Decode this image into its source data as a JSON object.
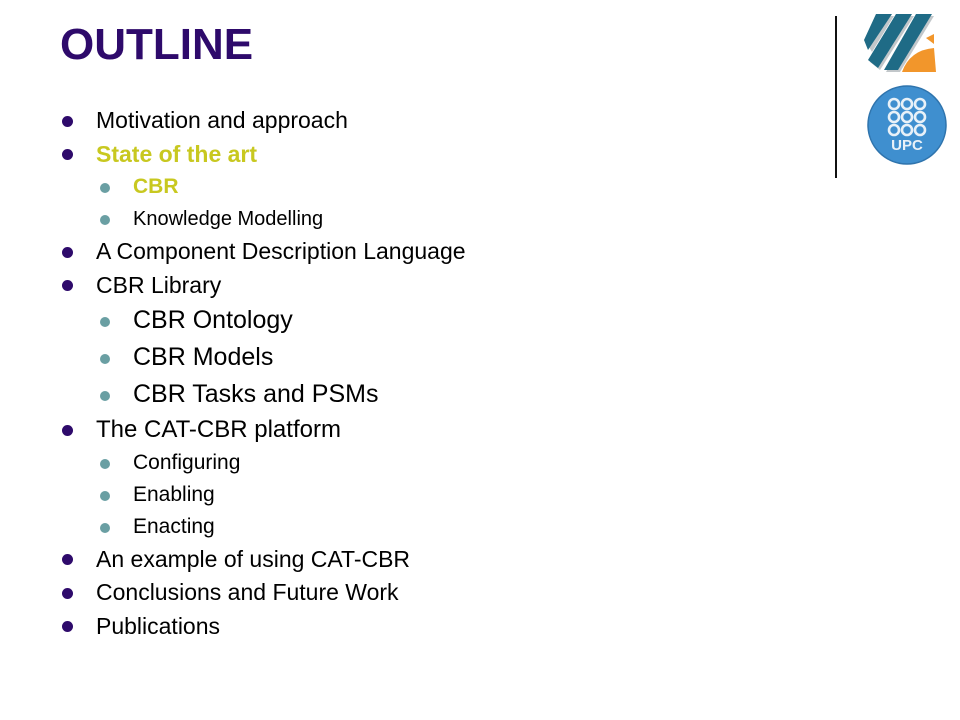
{
  "slide": {
    "title": "OUTLINE",
    "colors": {
      "title": "#2e0a6b",
      "highlight": "#c8c820",
      "bullet_level1": "#2e0a6b",
      "bullet_level2": "#6a9fa3"
    },
    "logos": [
      {
        "name": "institute-logo",
        "description": "striped blue and orange emblem"
      },
      {
        "name": "upc-logo",
        "text": "UPC"
      }
    ],
    "items": [
      {
        "label": "Motivation and approach",
        "level": 1
      },
      {
        "label": "State of the art",
        "level": 1,
        "highlighted": true
      },
      {
        "label": "CBR",
        "level": 2,
        "highlighted": true
      },
      {
        "label": "Knowledge Modelling",
        "level": 2
      },
      {
        "label": "A Component Description Language",
        "level": 1
      },
      {
        "label": "CBR Library",
        "level": 1
      },
      {
        "label": "CBR Ontology",
        "level": 2
      },
      {
        "label": "CBR Models",
        "level": 2
      },
      {
        "label": "CBR Tasks and PSMs",
        "level": 2
      },
      {
        "label": "The CAT-CBR platform",
        "level": 1
      },
      {
        "label": "Configuring",
        "level": 2
      },
      {
        "label": "Enabling",
        "level": 2
      },
      {
        "label": "Enacting",
        "level": 2
      },
      {
        "label": "An example of using CAT-CBR",
        "level": 1
      },
      {
        "label": "Conclusions and Future Work",
        "level": 1
      },
      {
        "label": "Publications",
        "level": 1
      }
    ]
  }
}
